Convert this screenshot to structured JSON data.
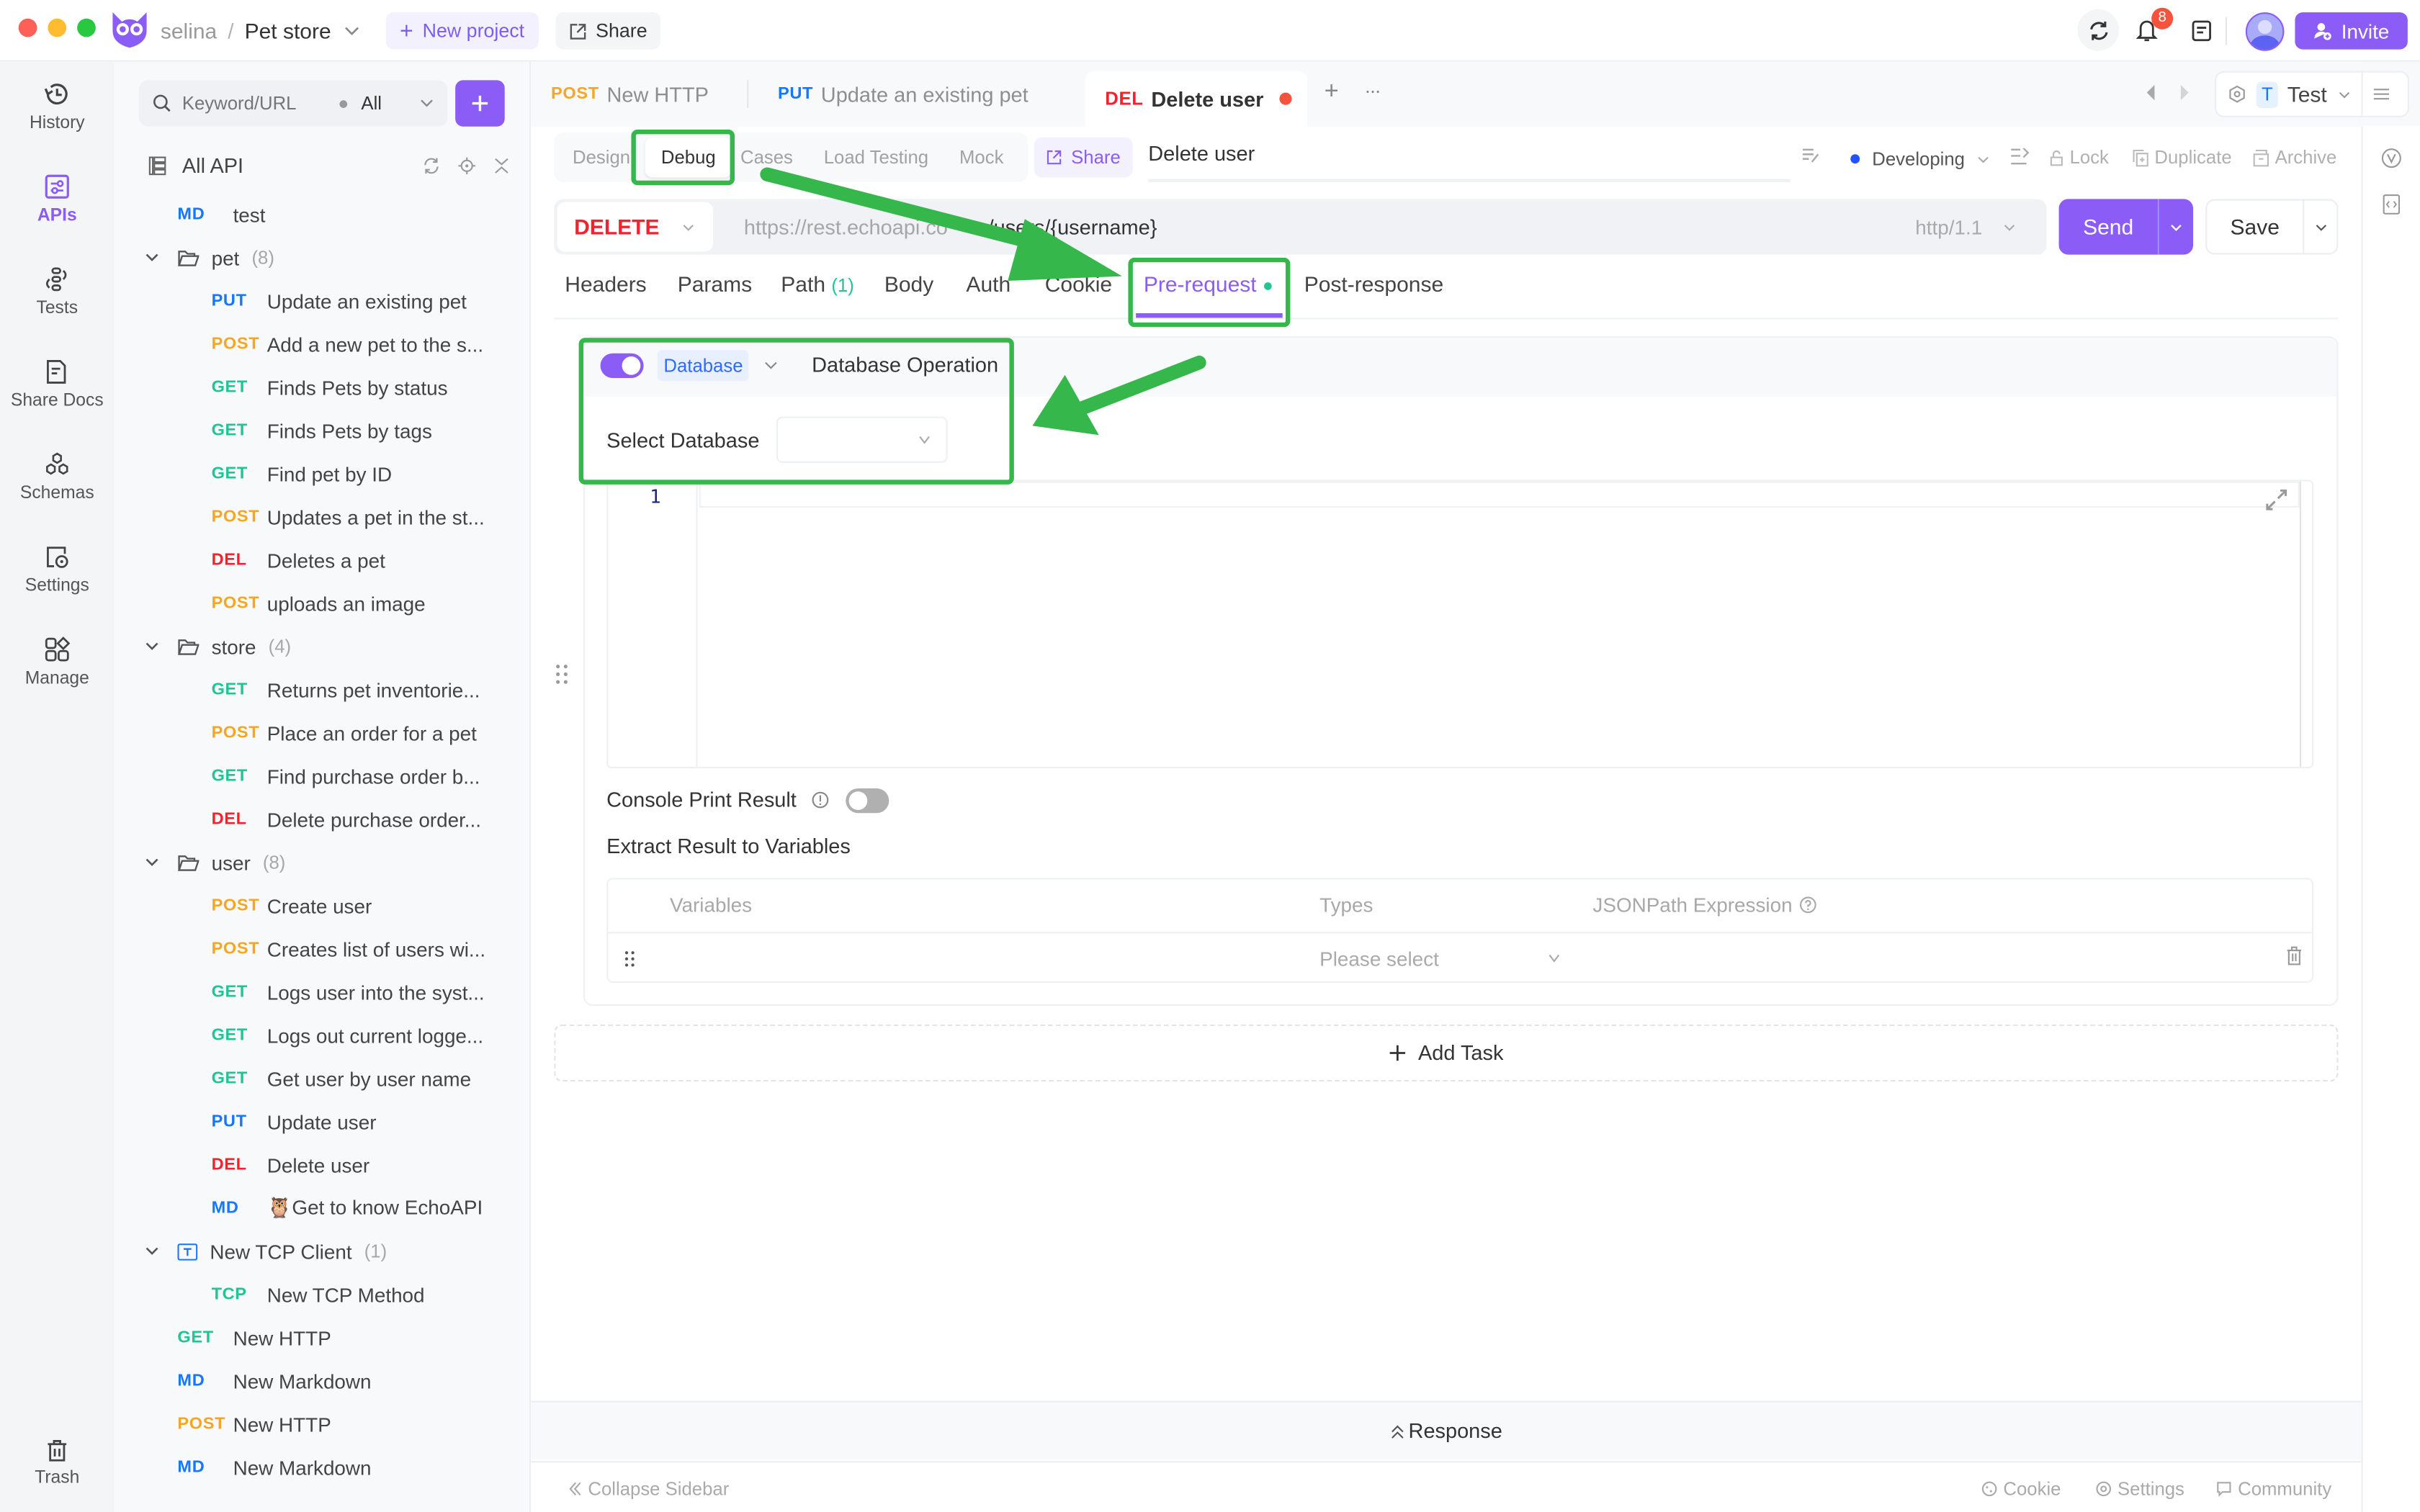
{
  "titlebar": {
    "workspace": "selina",
    "separator": "/",
    "project": "Pet store",
    "new_project": "New project",
    "share": "Share",
    "notification_count": "8",
    "invite": "Invite",
    "brand_color": "#8b5cf6"
  },
  "rail": {
    "items": [
      {
        "label": "History",
        "icon": "history-icon"
      },
      {
        "label": "APIs",
        "icon": "apis-icon",
        "active": true
      },
      {
        "label": "Tests",
        "icon": "tests-icon"
      },
      {
        "label": "Share Docs",
        "icon": "share-docs-icon"
      },
      {
        "label": "Schemas",
        "icon": "schemas-icon"
      },
      {
        "label": "Settings",
        "icon": "settings-icon"
      },
      {
        "label": "Manage",
        "icon": "manage-icon"
      }
    ],
    "trash": "Trash"
  },
  "sidebar": {
    "search_placeholder": "Keyword/URL",
    "filter": "All",
    "root_label": "All API",
    "tree": [
      {
        "type": "item",
        "method": "MD",
        "name": "test",
        "depth": 1
      },
      {
        "type": "folder",
        "name": "pet",
        "count": "(8)"
      },
      {
        "type": "item",
        "method": "PUT",
        "name": "Update an existing pet",
        "depth": 2
      },
      {
        "type": "item",
        "method": "POST",
        "name": "Add a new pet to the s...",
        "depth": 2
      },
      {
        "type": "item",
        "method": "GET",
        "name": "Finds Pets by status",
        "depth": 2
      },
      {
        "type": "item",
        "method": "GET",
        "name": "Finds Pets by tags",
        "depth": 2
      },
      {
        "type": "item",
        "method": "GET",
        "name": "Find pet by ID",
        "depth": 2
      },
      {
        "type": "item",
        "method": "POST",
        "name": "Updates a pet in the st...",
        "depth": 2
      },
      {
        "type": "item",
        "method": "DEL",
        "name": "Deletes a pet",
        "depth": 2
      },
      {
        "type": "item",
        "method": "POST",
        "name": "uploads an image",
        "depth": 2
      },
      {
        "type": "folder",
        "name": "store",
        "count": "(4)"
      },
      {
        "type": "item",
        "method": "GET",
        "name": "Returns pet inventorie...",
        "depth": 2
      },
      {
        "type": "item",
        "method": "POST",
        "name": "Place an order for a pet",
        "depth": 2
      },
      {
        "type": "item",
        "method": "GET",
        "name": "Find purchase order b...",
        "depth": 2
      },
      {
        "type": "item",
        "method": "DEL",
        "name": "Delete purchase order...",
        "depth": 2
      },
      {
        "type": "folder",
        "name": "user",
        "count": "(8)"
      },
      {
        "type": "item",
        "method": "POST",
        "name": "Create user",
        "depth": 2
      },
      {
        "type": "item",
        "method": "POST",
        "name": "Creates list of users wi...",
        "depth": 2
      },
      {
        "type": "item",
        "method": "GET",
        "name": "Logs user into the syst...",
        "depth": 2
      },
      {
        "type": "item",
        "method": "GET",
        "name": "Logs out current logge...",
        "depth": 2
      },
      {
        "type": "item",
        "method": "GET",
        "name": "Get user by user name",
        "depth": 2
      },
      {
        "type": "item",
        "method": "PUT",
        "name": "Update user",
        "depth": 2
      },
      {
        "type": "item",
        "method": "DEL",
        "name": "Delete user",
        "depth": 2
      },
      {
        "type": "item",
        "method": "MD",
        "name": "🦉Get to know EchoAPI",
        "depth": 2
      },
      {
        "type": "tcp-folder",
        "name": "New TCP Client",
        "count": "(1)"
      },
      {
        "type": "item",
        "method": "TCP",
        "name": "New TCP Method",
        "depth": 2
      },
      {
        "type": "item",
        "method": "GET",
        "name": "New HTTP",
        "depth": 1
      },
      {
        "type": "item",
        "method": "MD",
        "name": "New Markdown",
        "depth": 1
      },
      {
        "type": "item",
        "method": "POST",
        "name": "New HTTP",
        "depth": 1
      },
      {
        "type": "item",
        "method": "MD",
        "name": "New Markdown",
        "depth": 1
      }
    ]
  },
  "method_colors": {
    "GET": "#22c493",
    "POST": "#f5a623",
    "PUT": "#1677ff",
    "DEL": "#f5222d",
    "MD": "#1677ff",
    "TCP": "#22c493",
    "DELETE": "#f5222d"
  },
  "open_tabs": [
    {
      "method": "POST",
      "name": "New HTTP"
    },
    {
      "method": "PUT",
      "name": "Update an existing pet"
    },
    {
      "method": "DEL",
      "name": "Delete user",
      "active": true,
      "unsaved": true
    }
  ],
  "environment": {
    "badge": "T",
    "name": "Test"
  },
  "mode_tabs": [
    "Design",
    "Debug",
    "Cases",
    "Load Testing",
    "Mock"
  ],
  "active_mode": "Debug",
  "share_label": "Share",
  "api_name": "Delete user",
  "status": {
    "label": "Developing",
    "color": "#2452ff"
  },
  "actions": {
    "lock": "Lock",
    "duplicate": "Duplicate",
    "archive": "Archive"
  },
  "request": {
    "method": "DELETE",
    "url_base": "https://rest.echoapi.co",
    "url_path": "/users/{username}",
    "protocol": "http/1.1",
    "send": "Send",
    "save": "Save"
  },
  "request_tabs": [
    {
      "label": "Headers"
    },
    {
      "label": "Params"
    },
    {
      "label": "Path",
      "count": "(1)"
    },
    {
      "label": "Body"
    },
    {
      "label": "Auth"
    },
    {
      "label": "Cookie"
    },
    {
      "label": "Pre-request",
      "active": true,
      "dot": true
    },
    {
      "label": "Post-response"
    }
  ],
  "task": {
    "enabled": true,
    "type": "Database",
    "title": "Database Operation",
    "select_db_label": "Select Database",
    "select_db_value": "",
    "editor_line": "1",
    "console_print_label": "Console Print Result",
    "console_print_enabled": false,
    "extract_label": "Extract Result to Variables",
    "table_headers": [
      "Variables",
      "Types",
      "JSONPath Expression"
    ],
    "types_placeholder": "Please select"
  },
  "add_task": "Add Task",
  "response_label": "Response",
  "footer": {
    "collapse": "Collapse Sidebar",
    "cookie": "Cookie",
    "settings": "Settings",
    "community": "Community"
  }
}
